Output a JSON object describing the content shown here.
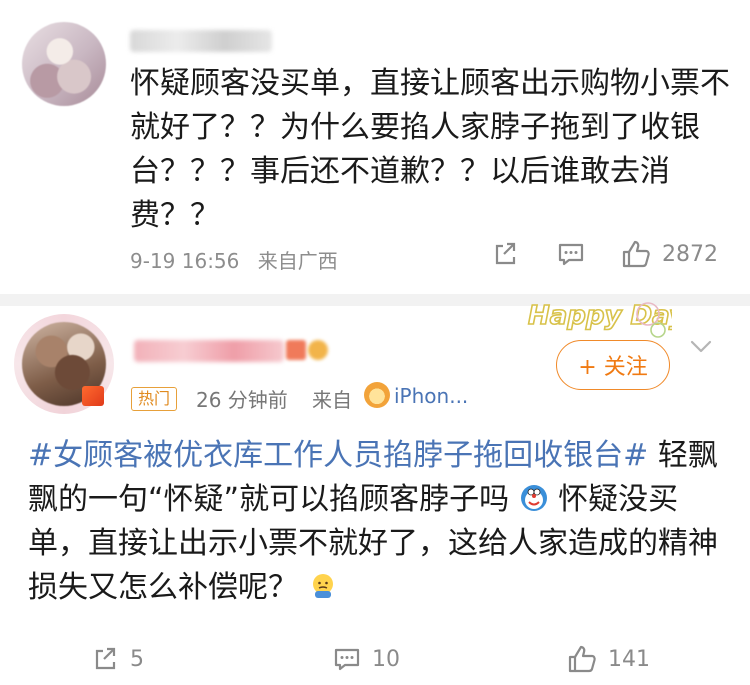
{
  "comment1": {
    "text": "怀疑顾客没买单，直接让顾客出示购物小票不就好了？？为什么要掐人家脖子拖到了收银台？？？事后还不道歉？？以后谁敢去消费？？",
    "date": "9-19 16:56",
    "source": "来自广西",
    "likes": "2872"
  },
  "comment2": {
    "hot_label": "热门",
    "time": "26 分钟前",
    "from_label": "来自",
    "device": "iPhon...",
    "follow_label": "+ 关注",
    "decor_text": "Happy Day",
    "hashtag": "#女顾客被优衣库工作人员掐脖子拖回收银台#",
    "text_part1": " 轻飘飘的一句“怀疑”就可以掐顾客脖子吗",
    "text_part2": " 怀疑没买单，直接让出示小票不就好了，这给人家造成的精神损失又怎么补偿呢？",
    "shares": "5",
    "comments": "10",
    "likes": "141"
  },
  "icons": {
    "share": "share-icon",
    "comment": "comment-icon",
    "like": "thumbs-up-icon",
    "more": "chevron-down-icon"
  },
  "colors": {
    "link": "#4a74b5",
    "follow": "#f07a12",
    "meta": "#8d8d8d"
  }
}
